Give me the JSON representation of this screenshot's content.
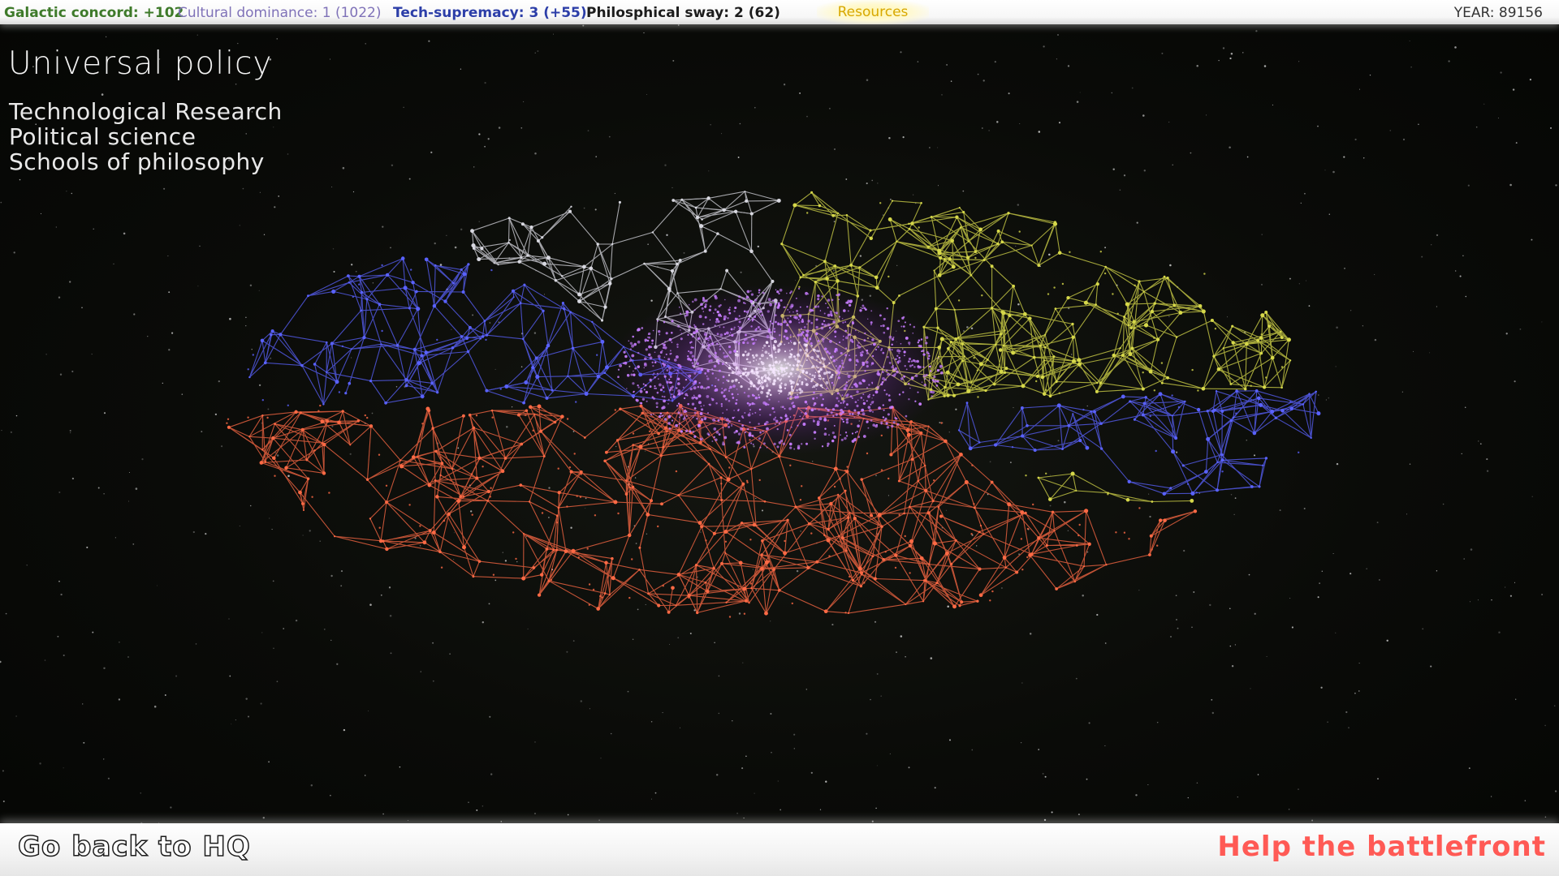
{
  "topbar": {
    "concord": {
      "text": "Galactic concord: +102",
      "color": "#3e7a2a"
    },
    "cultural": {
      "text": "Cultural dominance: 1 (1022)",
      "color": "#7f72b8"
    },
    "tech": {
      "text": "Tech-supremacy: 3 (+55)",
      "color": "#2c3ea8"
    },
    "philo": {
      "text": "Philosphical sway: 2 (62)",
      "color": "#1c1c1c"
    },
    "resources": {
      "text": "Resources",
      "color": "#d8a800"
    },
    "year": "YEAR: 89156"
  },
  "policy": {
    "title": "Universal policy",
    "items": [
      {
        "label": "Technological Research"
      },
      {
        "label": "Political science"
      },
      {
        "label": "Schools of philosophy"
      }
    ]
  },
  "bottombar": {
    "back_label": "Go back to HQ",
    "battle_label": "Help the battlefront"
  },
  "map": {
    "factions": [
      {
        "name": "blue",
        "color": "#5a62ff"
      },
      {
        "name": "white",
        "color": "#d8d8e0"
      },
      {
        "name": "yellow",
        "color": "#d6d84a"
      },
      {
        "name": "red",
        "color": "#ff6a45"
      },
      {
        "name": "core",
        "color": "#c77dff"
      }
    ]
  }
}
